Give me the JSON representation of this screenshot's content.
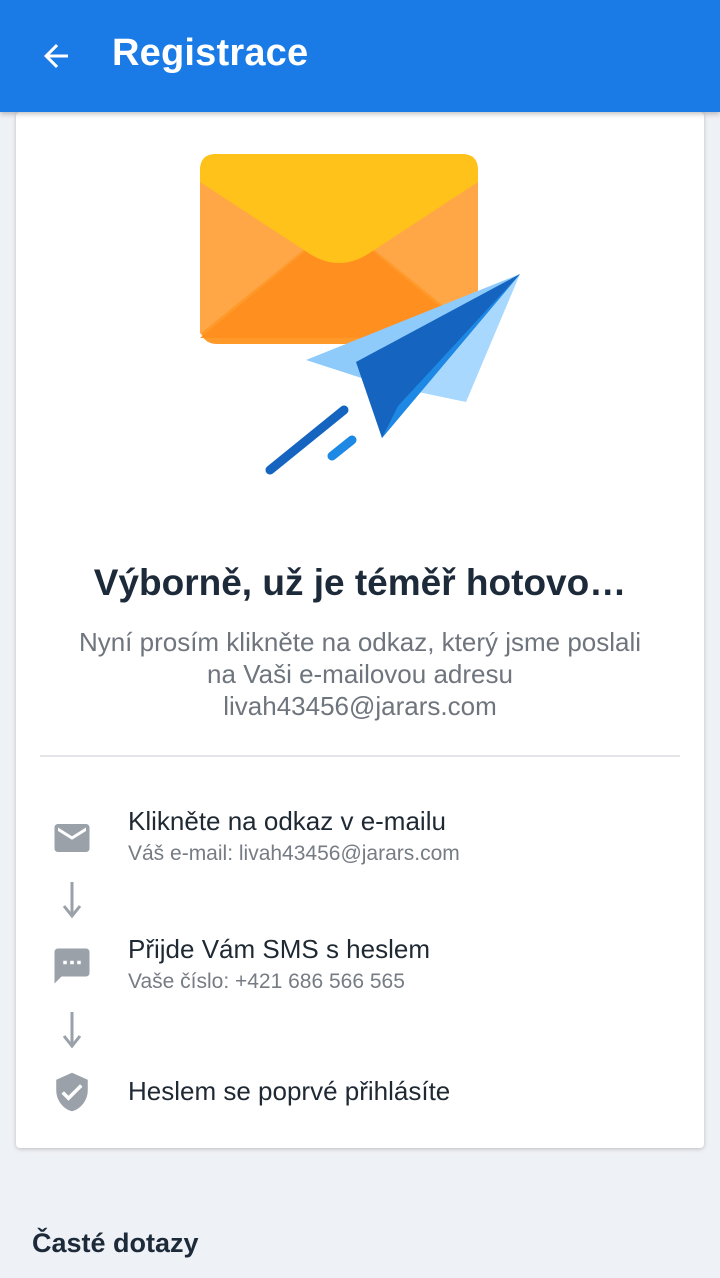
{
  "appbar": {
    "title": "Registrace",
    "back_icon": "arrow-left-icon",
    "background_color": "#1a7be6"
  },
  "hero": {
    "illustration": "envelope-paper-plane-illustration",
    "headline": "Výborně, už je téměř hotovo…",
    "description_lines": [
      "Nyní prosím klikněte na odkaz, který jsme poslali",
      "na Vaši e-mailovou adresu",
      "livah43456@jarars.com"
    ]
  },
  "steps": [
    {
      "icon": "mail-icon",
      "title": "Klikněte na odkaz v e-mailu",
      "subtitle": "Váš e-mail: livah43456@jarars.com"
    },
    {
      "icon": "sms-icon",
      "title": "Přijde Vám SMS s heslem",
      "subtitle": "Vaše číslo: +421 686 566 565"
    },
    {
      "icon": "shield-check-icon",
      "title": "Heslem se poprvé přihlásíte",
      "subtitle": ""
    }
  ],
  "faq": {
    "title": "Časté dotazy"
  }
}
